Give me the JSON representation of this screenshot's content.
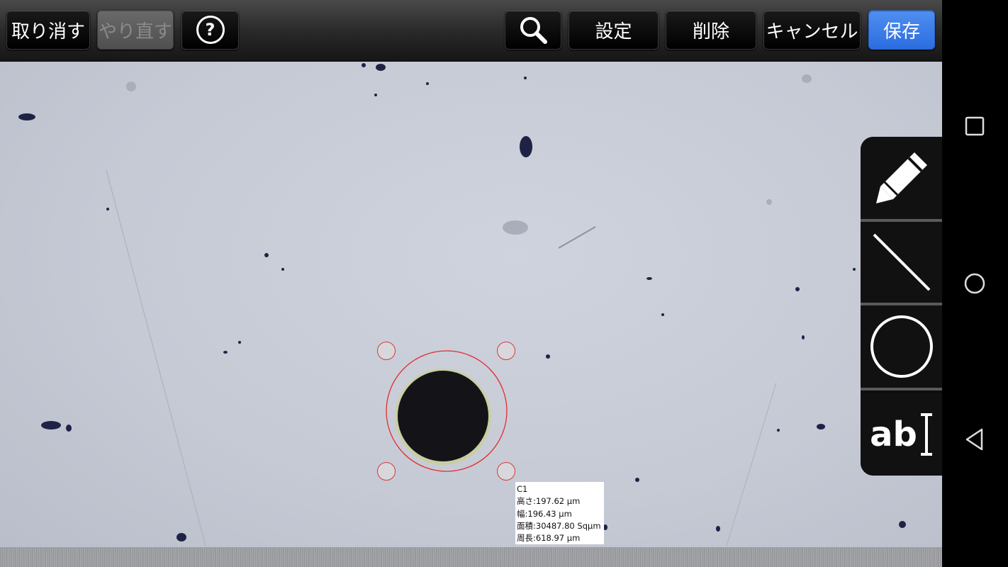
{
  "toolbar": {
    "undo_label": "取り消す",
    "redo_label": "やり直す",
    "help_label": "?",
    "settings_label": "設定",
    "delete_label": "削除",
    "cancel_label": "キャンセル",
    "save_label": "保存",
    "search_icon": "magnifier-icon"
  },
  "tools": {
    "pencil": "pencil-icon",
    "line": "line-icon",
    "circle": "circle-icon",
    "text_label": "ab"
  },
  "measurement": {
    "name": "C1",
    "height": "高さ:197.62 µm",
    "width": "幅:196.43 µm",
    "area": "面積:30487.80 Sqµm",
    "perimeter": "周長:618.97 µm"
  },
  "colors": {
    "accent": "#2b6de0",
    "measure_stroke": "#e03030"
  },
  "navigation": {
    "recent": "square-icon",
    "home": "circle-icon",
    "back": "triangle-back-icon"
  }
}
